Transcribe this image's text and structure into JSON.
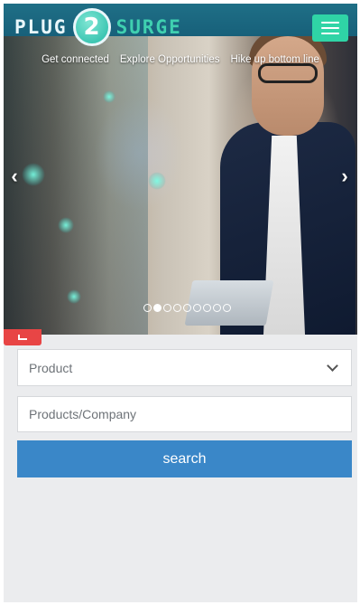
{
  "header": {
    "logo_left": "PLUG",
    "logo_badge": "2",
    "logo_right": "SURGE",
    "menu_icon": "hamburger-menu-icon"
  },
  "hero": {
    "nav_links": [
      {
        "label": "Get connected"
      },
      {
        "label": "Explore Opportunities"
      },
      {
        "label": "Hike up bottom line"
      }
    ],
    "prev_icon": "chevron-left-icon",
    "next_icon": "chevron-right-icon",
    "slides_total": 9,
    "active_slide": 2
  },
  "search_form": {
    "product_select": {
      "value": "Product",
      "icon": "chevron-down-icon"
    },
    "query_input": {
      "placeholder": "Products/Company",
      "value": ""
    },
    "search_button": {
      "label": "search"
    }
  },
  "colors": {
    "header_bg": "#17607a",
    "menu_button": "#2fd4a6",
    "search_button": "#3a87c8",
    "page_bg": "#ebecee",
    "red_tab": "#e84545"
  }
}
